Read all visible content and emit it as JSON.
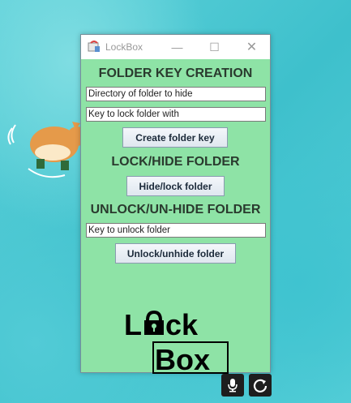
{
  "window": {
    "title": "LockBox",
    "minimize_glyph": "—",
    "maximize_glyph": "☐",
    "close_glyph": "✕"
  },
  "sections": {
    "key_creation": {
      "heading": "FOLDER KEY CREATION",
      "directory_field": "Directory of folder to hide",
      "key_field": "Key to lock folder with",
      "button": "Create folder key"
    },
    "lock_hide": {
      "heading": "LOCK/HIDE FOLDER",
      "button": "Hide/lock folder"
    },
    "unlock_unhide": {
      "heading": "UNLOCK/UN-HIDE FOLDER",
      "key_field": "Key to unlock folder",
      "button": "Unlock/unhide folder"
    }
  },
  "logo": {
    "word1": "Lck",
    "word2": "Box"
  },
  "icons": {
    "app": "app-icon",
    "mic": "microphone-icon",
    "refresh": "refresh-icon"
  },
  "colors": {
    "window_bg": "#8ee3a6",
    "wallpaper": "#46c3cf",
    "icon_button_bg": "#1e1e1e"
  }
}
